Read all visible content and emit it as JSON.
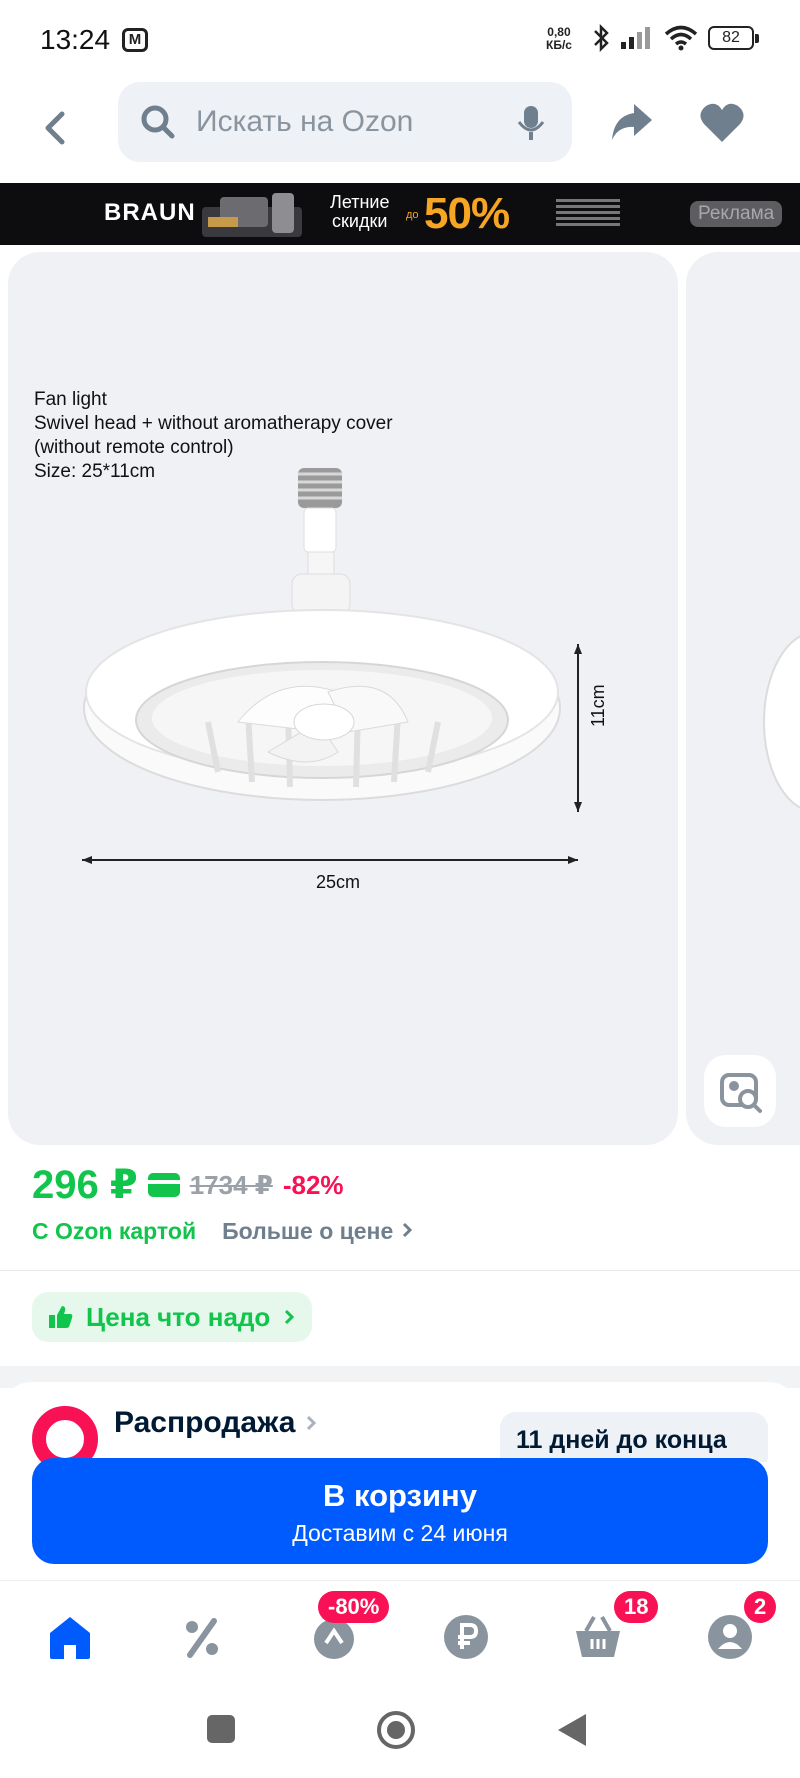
{
  "status": {
    "time": "13:24",
    "net_speed_top": "0,80",
    "net_speed_bottom": "КБ/с",
    "battery": "82"
  },
  "header": {
    "search_placeholder": "Искать на Ozon"
  },
  "ad": {
    "brand": "BRAUN",
    "text_line1": "Летние",
    "text_line2": "скидки",
    "prefix": "до",
    "percent": "50%",
    "label": "Реклама"
  },
  "product": {
    "caption": [
      "Fan light",
      "Swivel head + without aromatherapy cover",
      "(without remote control)",
      "Size: 25*11cm"
    ],
    "width_label": "25cm",
    "height_label": "11cm"
  },
  "price": {
    "current": "296 ₽",
    "old": "1734 ₽",
    "discount": "-82%",
    "card_text": "С Ozon картой",
    "more_label": "Больше о цене"
  },
  "value_badge": {
    "label": "Цена что надо"
  },
  "sale": {
    "title": "Распродажа",
    "days_left": "11 дней до конца"
  },
  "cart": {
    "title": "В корзину",
    "delivery": "Доставим с 24 июня"
  },
  "tabbar": {
    "promo_badge": "-80%",
    "cart_badge": "18",
    "profile_badge": "2"
  },
  "colors": {
    "ozon_blue": "#005bff",
    "green": "#10c44c",
    "pink": "#f91155"
  }
}
